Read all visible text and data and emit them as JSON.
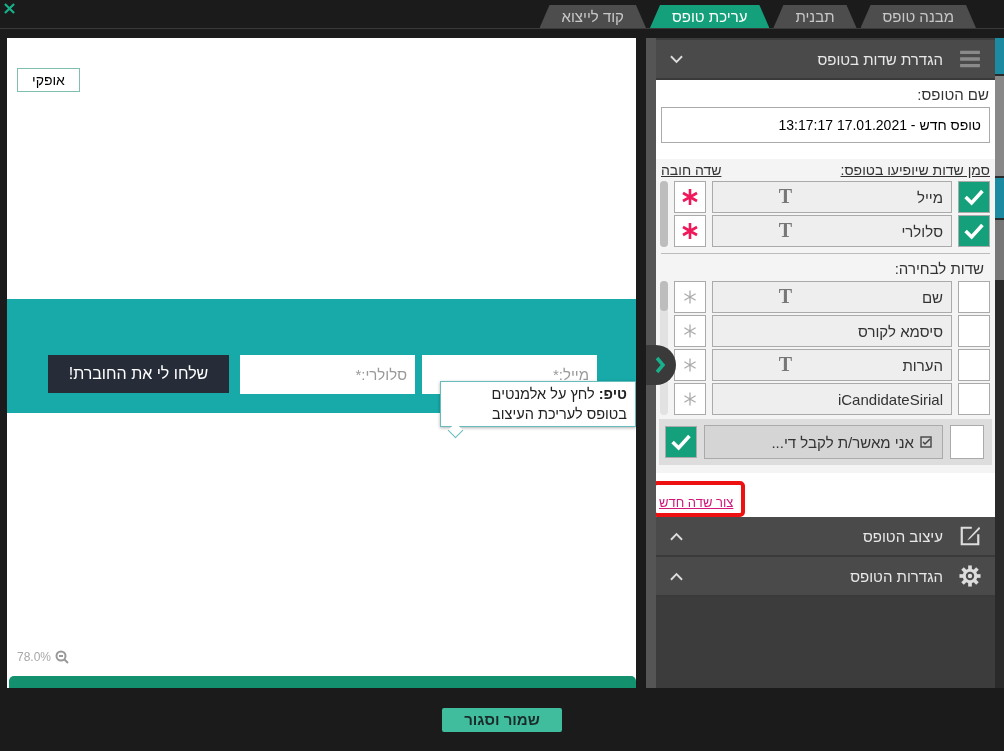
{
  "tabs": [
    {
      "label": "מבנה טופס",
      "selected": false
    },
    {
      "label": "תבנית",
      "selected": false
    },
    {
      "label": "עריכת טופס",
      "selected": true
    },
    {
      "label": "קוד לייצוא",
      "selected": false
    }
  ],
  "canvas": {
    "layout_button": "אופקי",
    "fields": [
      {
        "placeholder": "מייל:*"
      },
      {
        "placeholder": "סלולרי:*"
      }
    ],
    "submit": "שלחו לי את החוברת!",
    "tip": "**טיפ:** לחץ על אלמנטים בטופס לעריכת העיצוב",
    "zoom": "78.0%"
  },
  "panel": {
    "sections": [
      {
        "title": "הגדרת שדות בטופס",
        "kind": "fields",
        "expanded": true
      },
      {
        "title": "עיצוב הטופס",
        "kind": "design",
        "expanded": false
      },
      {
        "title": "הגדרות הטופס",
        "kind": "settings",
        "expanded": false
      }
    ],
    "form_name_label": "שם הטופס:",
    "form_name": "טופס חדש - 17.01.2021 13:17:17",
    "shown_label": "סמן שדות שיופיעו בטופס:",
    "required_label": "שדה חובה",
    "shown_fields": [
      {
        "name": "מייל",
        "type_icon": "T",
        "checked": true,
        "required": true
      },
      {
        "name": "סלולרי",
        "type_icon": "T",
        "checked": true,
        "required": true
      }
    ],
    "available_label": "שדות לבחירה:",
    "available_fields": [
      {
        "name": "שם",
        "type_icon": "T",
        "checked": false,
        "required": false
      },
      {
        "name": "סיסמא לקורס",
        "checked": false,
        "required": false
      },
      {
        "name": "הערות",
        "type_icon": "T",
        "checked": false,
        "required": false
      },
      {
        "name": "iCandidateSirial",
        "checked": false,
        "required": false
      }
    ],
    "consent": {
      "label": "אני מאשר/ת לקבל די...",
      "checked": false,
      "required": true
    },
    "new_field_link": "צור שדה חדש"
  },
  "save_button": "שמור וסגור"
}
